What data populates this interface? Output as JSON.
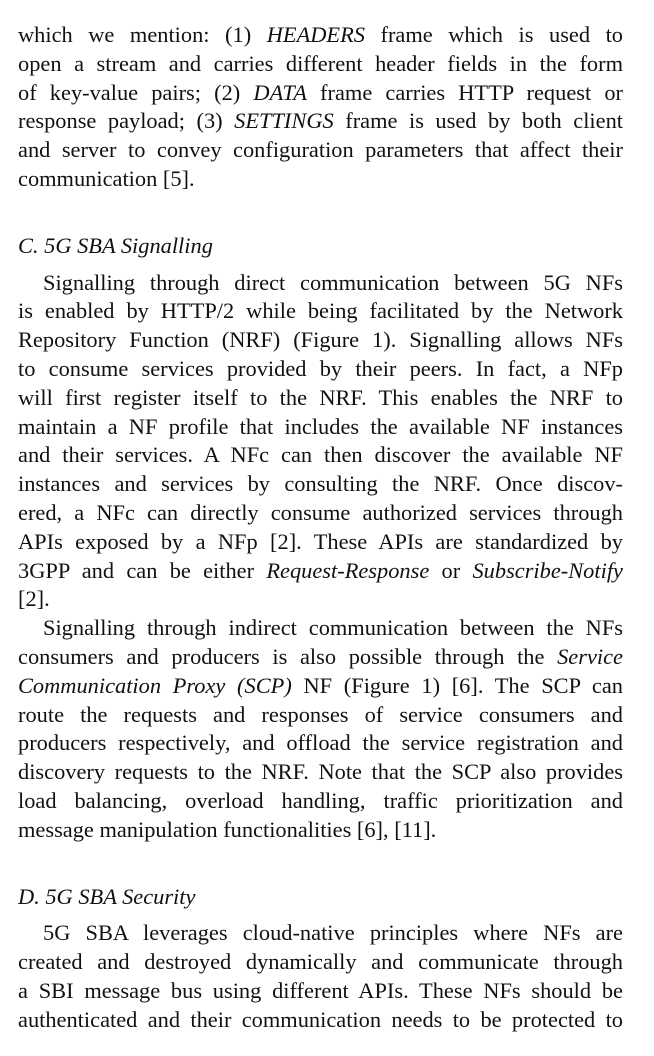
{
  "para1": {
    "lines": [
      [
        "which we mention: (1) ",
        {
          "i": "HEADERS"
        },
        " frame which is used to"
      ],
      [
        "open a stream and carries different header fields in the form"
      ],
      [
        "of key-value pairs; (2) ",
        {
          "i": "DATA"
        },
        " frame carries HTTP request or"
      ],
      [
        "response payload; (3) ",
        {
          "i": "SETTINGS"
        },
        " frame is used by both client"
      ],
      [
        "and server to convey configuration parameters that affect their"
      ],
      [
        "communication [5]."
      ]
    ]
  },
  "sectionC": {
    "title": "C.  5G SBA Signalling"
  },
  "para2": {
    "lines": [
      [
        "Signalling through direct communication between 5G NFs"
      ],
      [
        "is enabled by HTTP/2 while being facilitated by the Network"
      ],
      [
        "Repository Function (NRF) (Figure 1). Signalling allows NFs"
      ],
      [
        "to consume services provided by their peers. In fact, a NFp"
      ],
      [
        "will first register itself to the NRF. This enables the NRF to"
      ],
      [
        "maintain a NF profile that includes the available NF instances"
      ],
      [
        "and their services. A NFc can then discover the available NF"
      ],
      [
        "instances and services by consulting the NRF. Once discov-"
      ],
      [
        "ered, a NFc can directly consume authorized services through"
      ],
      [
        "APIs exposed by a NFp [2]. These APIs are standardized by"
      ],
      [
        "3GPP and can be either ",
        {
          "i": "Request-Response"
        },
        " or ",
        {
          "i": "Subscribe-Notify"
        }
      ],
      [
        "[2]."
      ]
    ]
  },
  "para3": {
    "lines": [
      [
        "Signalling through indirect communication between the NFs"
      ],
      [
        "consumers and producers is also possible through the ",
        {
          "i": "Service"
        }
      ],
      [
        {
          "i": "Communication Proxy (SCP)"
        },
        " NF (Figure 1) [6]. The SCP can"
      ],
      [
        "route the requests and responses of service consumers and"
      ],
      [
        "producers respectively, and offload the service registration and"
      ],
      [
        "discovery requests to the NRF. Note that the SCP also provides"
      ],
      [
        "load balancing, overload handling, traffic prioritization and"
      ],
      [
        "message manipulation functionalities [6], [11]."
      ]
    ]
  },
  "sectionD": {
    "title": "D.  5G SBA Security"
  },
  "para4": {
    "lines": [
      [
        "5G SBA leverages cloud-native principles where NFs are"
      ],
      [
        "created and destroyed dynamically and communicate through"
      ],
      [
        "a SBI message bus using different APIs. These NFs should be"
      ],
      [
        "authenticated and their communication needs to be protected to"
      ]
    ]
  }
}
